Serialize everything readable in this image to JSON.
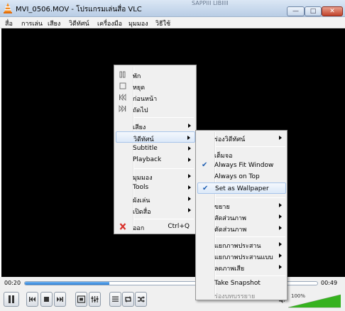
{
  "window": {
    "title": "MVI_0506.MOV - โปรแกรมเล่นสื่อ VLC",
    "background_title_fragment": "SAPPIII LIBIIII",
    "buttons": {
      "minimize": "—",
      "maximize": "□",
      "close": "✕"
    }
  },
  "menubar": {
    "items": [
      "สื่อ",
      "การเล่น",
      "เสียง",
      "วิดีทัศน์",
      "เครื่องมือ",
      "มุมมอง",
      "วิธีใช้"
    ]
  },
  "playback": {
    "elapsed": "00:20",
    "remaining": "00:49",
    "progress_fraction": 0.29,
    "volume_label": "100%",
    "volume_fraction": 1.0
  },
  "context_menu": {
    "items": [
      {
        "label": "พัก",
        "icon": "pause-icon"
      },
      {
        "label": "หยุด",
        "icon": "stop-icon"
      },
      {
        "label": "ก่อนหน้า",
        "icon": "previous-icon"
      },
      {
        "label": "ถัดไป",
        "icon": "next-icon"
      },
      {
        "label": "เสียง",
        "submenu": true
      },
      {
        "label": "วิดีทัศน์",
        "submenu": true,
        "highlighted": true
      },
      {
        "label": "Subtitle",
        "submenu": true
      },
      {
        "label": "Playback",
        "submenu": true
      },
      {
        "label": "มุมมอง",
        "submenu": true
      },
      {
        "label": "Tools",
        "submenu": true
      },
      {
        "label": "ผังเล่น",
        "submenu": true
      },
      {
        "label": "เปิดสื่อ",
        "submenu": true
      },
      {
        "label": "ออก",
        "accelerator": "Ctrl+Q",
        "icon": "quit-icon"
      }
    ]
  },
  "video_submenu": {
    "items": [
      {
        "label": "ร่องวิดีทัศน์",
        "submenu": true
      },
      {
        "label": "เต็มจอ"
      },
      {
        "label": "Always Fit Window",
        "checked": true
      },
      {
        "label": "Always on Top"
      },
      {
        "label": "Set as Wallpaper",
        "checked": true,
        "highlighted": true
      },
      {
        "label": "ขยาย",
        "submenu": true
      },
      {
        "label": "สัดส่วนภาพ",
        "submenu": true
      },
      {
        "label": "ตัดส่วนภาพ",
        "submenu": true
      },
      {
        "label": "แยกภาพประสาน",
        "submenu": true
      },
      {
        "label": "แยกภาพประสานแบบ",
        "submenu": true
      },
      {
        "label": "ลดภาพเสีย",
        "submenu": true
      },
      {
        "label": "Take Snapshot"
      },
      {
        "label": "ร่องบทบรรยาย",
        "disabled": true
      }
    ]
  },
  "colors": {
    "video_bg": "#000000",
    "seek_fill": "#2c7fd4",
    "volume_fill": "#36b21f",
    "check": "#1f5fb3",
    "quit_icon": "#d9302a"
  }
}
